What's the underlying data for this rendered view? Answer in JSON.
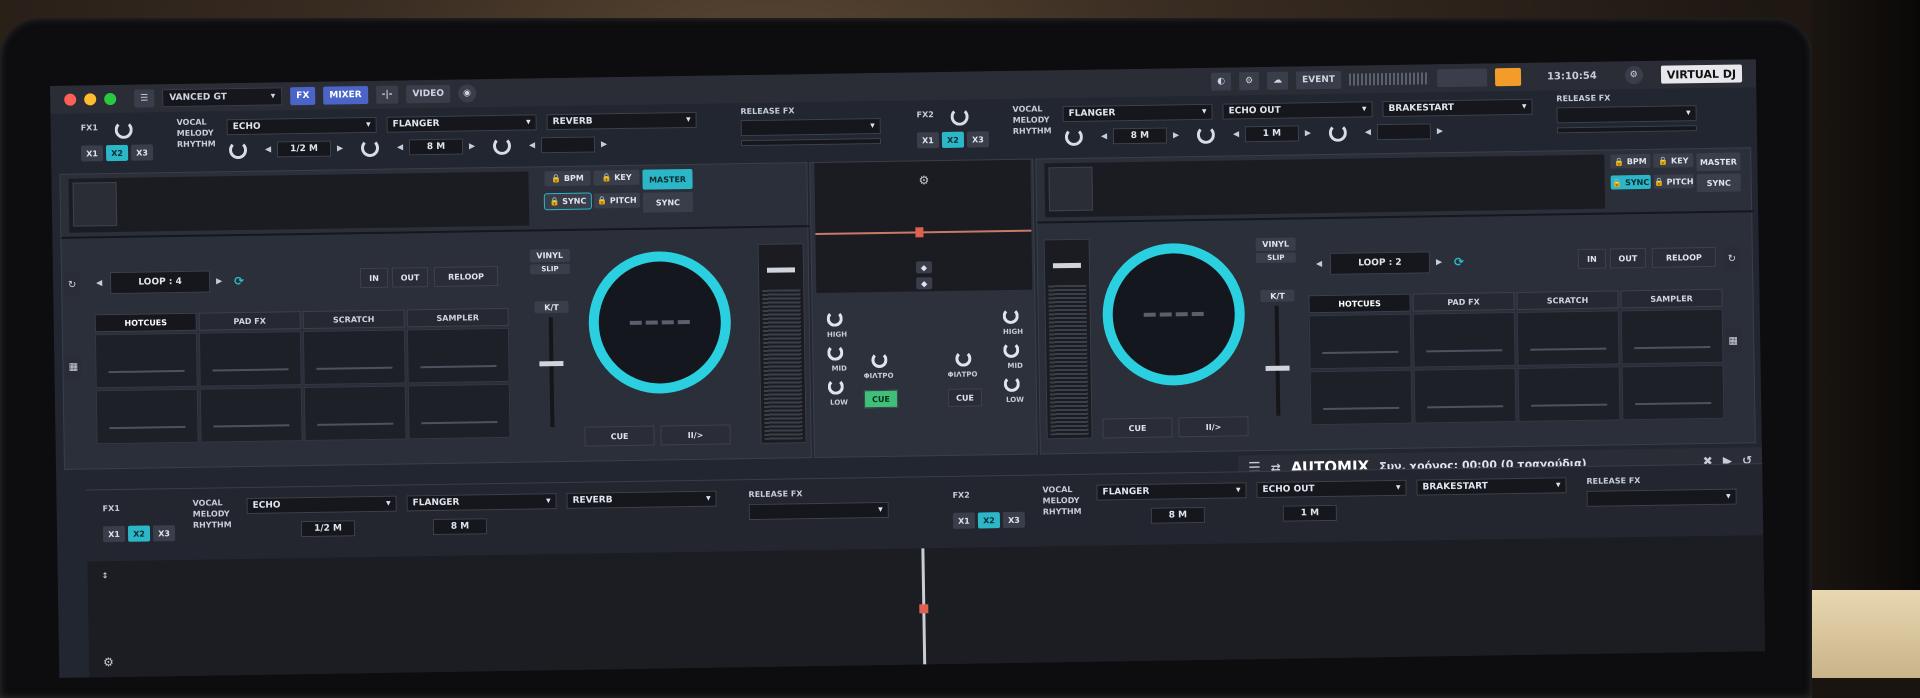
{
  "topbar": {
    "skin_select": "VANCED GT",
    "btn_fx": "FX",
    "btn_mixer": "MIXER",
    "btn_split": "-|-",
    "btn_video": "VIDEO",
    "btn_event": "EVENT",
    "clock": "13:10:54",
    "brand": "VIRTUAL DJ"
  },
  "fx1": {
    "label": "FX1",
    "x1": "X1",
    "x2": "X2",
    "x3": "X3",
    "vocal": "VOCAL",
    "melody": "MELODY",
    "rhythm": "RHYTHM",
    "slot1": "ECHO",
    "slot1_val": "1/2 M",
    "slot2": "FLANGER",
    "slot2_val": "8 M",
    "slot3": "REVERB",
    "release_label": "RELEASE FX"
  },
  "fx2": {
    "label": "FX2",
    "x1": "X1",
    "x2": "X2",
    "x3": "X3",
    "vocal": "VOCAL",
    "melody": "MELODY",
    "rhythm": "RHYTHM",
    "slot1": "FLANGER",
    "slot1_val": "8 M",
    "slot2": "ECHO OUT",
    "slot2_val": "1 M",
    "slot3": "BRAKESTART",
    "release_label": "RELEASE FX"
  },
  "deck_left": {
    "bpm_lock": "BPM",
    "key_lock": "KEY",
    "master": "MASTER",
    "sync_lock": "SYNC",
    "pitch_lock": "PITCH",
    "sync": "SYNC",
    "loop": "LOOP : 4",
    "in": "IN",
    "out": "OUT",
    "reloop": "RELOOP",
    "tabs": [
      "HOTCUES",
      "PAD FX",
      "SCRATCH",
      "SAMPLER"
    ],
    "vinyl": "VINYL",
    "slip": "SLIP",
    "kt": "K/T",
    "cue": "CUE",
    "play": "II/>"
  },
  "deck_right": {
    "bpm_lock": "BPM",
    "key_lock": "KEY",
    "master": "MASTER",
    "sync_lock": "SYNC",
    "pitch_lock": "PITCH",
    "sync": "SYNC",
    "loop": "LOOP : 2",
    "in": "IN",
    "out": "OUT",
    "reloop": "RELOOP",
    "tabs": [
      "HOTCUES",
      "PAD FX",
      "SCRATCH",
      "SAMPLER"
    ],
    "vinyl": "VINYL",
    "slip": "SLIP",
    "kt": "K/T",
    "cue": "CUE",
    "play": "II/>"
  },
  "mixer": {
    "high": "HIGH",
    "mid": "MID",
    "low": "LOW",
    "filter": "ΦΙΛΤΡΟ",
    "cue_left": "CUE",
    "cue_right": "CUE"
  },
  "automix": {
    "title": "AUTOMIX",
    "status": "Συν. χρόνος: 00:00 (0 τραγούδια)"
  },
  "colors": {
    "accent": "#2bd0e0",
    "panel": "#2b2f39",
    "bg": "#222630"
  }
}
